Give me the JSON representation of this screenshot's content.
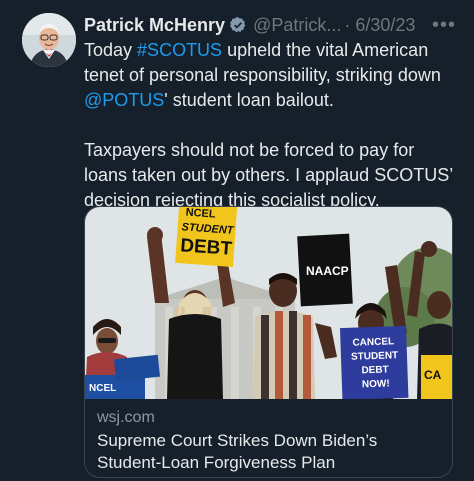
{
  "author": {
    "name": "Patrick McHenry",
    "handle": "@Patrick...",
    "separator": "·",
    "date": "6/30/23"
  },
  "more_label": "•••",
  "tweet": {
    "p1_before": "Today ",
    "p1_link1": "#SCOTUS",
    "p1_middle": " upheld the vital American tenet of personal responsibility, striking down ",
    "p1_link2": "@POTUS",
    "p1_after": "' student loan bailout.",
    "p2": "Taxpayers should not be forced to pay for loans taken out by others. I applaud SCOTUS’ decision rejecting this socialist policy."
  },
  "card": {
    "domain": "wsj.com",
    "title": "Supreme Court Strikes Down Biden’s Student-Loan Forgiveness Plan",
    "photo_signs": {
      "sign1_l1": "NCEL",
      "sign1_l2": "STUDENT",
      "sign1_l3": "DEBT",
      "sign2": "NAACP",
      "sign3_l1": "CANCEL",
      "sign3_l2": "STUDENT",
      "sign3_l3": "DEBT",
      "sign3_l4": "NOW!",
      "sign4": "CA",
      "sign5": "NCEL"
    }
  },
  "colors": {
    "background": "#15202b",
    "link": "#1d9bf0",
    "verified": "#829aab",
    "muted": "#71767b"
  }
}
